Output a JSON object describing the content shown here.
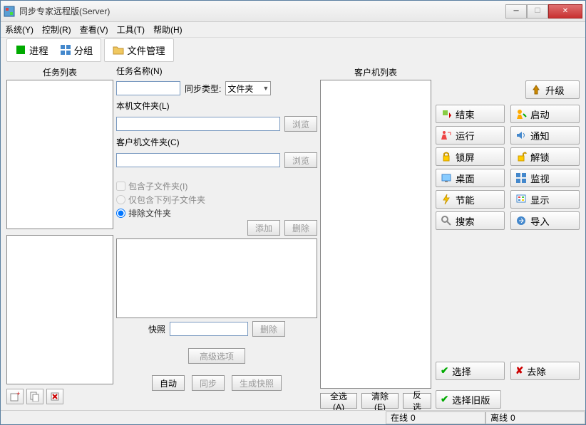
{
  "window": {
    "title": "同步专家远程版(Server)"
  },
  "menu": {
    "system": "系统(Y)",
    "control": "控制(R)",
    "view": "查看(V)",
    "tools": "工具(T)",
    "help": "帮助(H)"
  },
  "toolbar": {
    "process": "进程",
    "group": "分组",
    "file_mgmt": "文件管理"
  },
  "left": {
    "task_list_header": "任务列表"
  },
  "mid": {
    "task_name": "任务名称(N)",
    "sync_type_label": "同步类型:",
    "sync_type_value": "文件夹",
    "local_folder": "本机文件夹(L)",
    "client_folder": "客户机文件夹(C)",
    "browse": "浏览",
    "include_sub": "包含子文件夹(I)",
    "only_include": "仅包含下列子文件夹",
    "exclude": "排除文件夹",
    "add": "添加",
    "delete": "删除",
    "snapshot": "快照",
    "advanced": "高级选项",
    "auto": "自动",
    "sync": "同步",
    "gen_snapshot": "生成快照"
  },
  "right": {
    "client_list_header": "客户机列表",
    "upgrade": "升级",
    "end": "结束",
    "start": "启动",
    "run": "运行",
    "notify": "通知",
    "lock": "锁屏",
    "unlock": "解锁",
    "desktop": "桌面",
    "monitor": "监视",
    "energy": "节能",
    "display": "显示",
    "search": "搜索",
    "import": "导入",
    "select": "选择",
    "remove": "去除",
    "select_old": "选择旧版",
    "select_all": "全选(A)",
    "clear": "清除(E)",
    "invert": "反选"
  },
  "status": {
    "online_label": "在线",
    "online_count": "0",
    "offline_label": "离线",
    "offline_count": "0"
  }
}
